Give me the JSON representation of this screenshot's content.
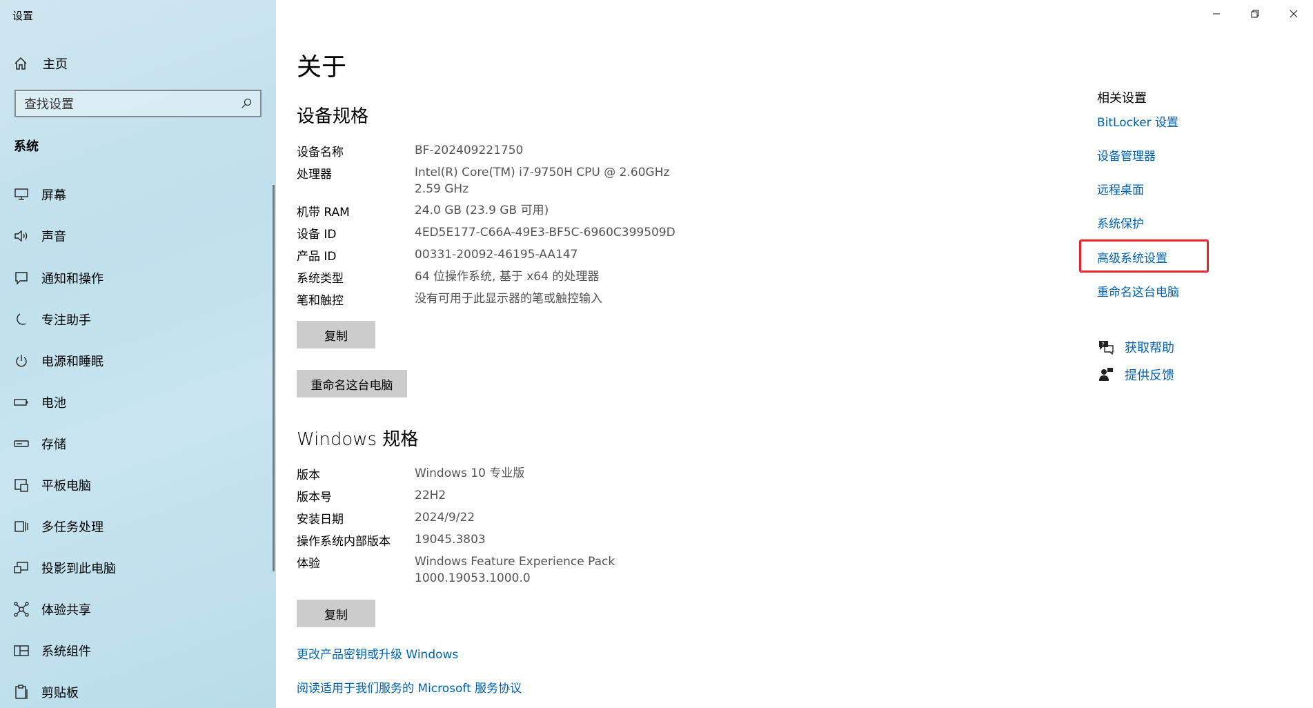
{
  "window": {
    "title": "设置"
  },
  "sidebar": {
    "home_label": "主页",
    "search_placeholder": "查找设置",
    "section": "系统",
    "items": [
      {
        "icon": "monitor-icon",
        "label": "屏幕"
      },
      {
        "icon": "speaker-icon",
        "label": "声音"
      },
      {
        "icon": "notification-icon",
        "label": "通知和操作"
      },
      {
        "icon": "moon-icon",
        "label": "专注助手"
      },
      {
        "icon": "power-icon",
        "label": "电源和睡眠"
      },
      {
        "icon": "battery-icon",
        "label": "电池"
      },
      {
        "icon": "storage-icon",
        "label": "存储"
      },
      {
        "icon": "tablet-icon",
        "label": "平板电脑"
      },
      {
        "icon": "multitask-icon",
        "label": "多任务处理"
      },
      {
        "icon": "project-icon",
        "label": "投影到此电脑"
      },
      {
        "icon": "share-icon",
        "label": "体验共享"
      },
      {
        "icon": "components-icon",
        "label": "系统组件"
      },
      {
        "icon": "clipboard-icon",
        "label": "剪贴板"
      }
    ]
  },
  "main": {
    "title": "关于",
    "device": {
      "heading": "设备规格",
      "rows": [
        {
          "k": "设备名称",
          "v": "BF-202409221750"
        },
        {
          "k": "处理器",
          "v": "Intel(R) Core(TM) i7-9750H CPU @ 2.60GHz   2.59 GHz"
        },
        {
          "k": "机带 RAM",
          "v": "24.0 GB (23.9 GB 可用)"
        },
        {
          "k": "设备 ID",
          "v": "4ED5E177-C66A-49E3-BF5C-6960C399509D"
        },
        {
          "k": "产品 ID",
          "v": "00331-20092-46195-AA147"
        },
        {
          "k": "系统类型",
          "v": "64 位操作系统, 基于 x64 的处理器"
        },
        {
          "k": "笔和触控",
          "v": "没有可用于此显示器的笔或触控输入"
        }
      ],
      "copy_label": "复制",
      "rename_label": "重命名这台电脑"
    },
    "windows": {
      "heading": "Windows 规格",
      "rows": [
        {
          "k": "版本",
          "v": "Windows 10 专业版"
        },
        {
          "k": "版本号",
          "v": "22H2"
        },
        {
          "k": "安装日期",
          "v": "2024/9/22"
        },
        {
          "k": "操作系统内部版本",
          "v": "19045.3803"
        },
        {
          "k": "体验",
          "v": "Windows Feature Experience Pack 1000.19053.1000.0"
        }
      ],
      "copy_label": "复制"
    },
    "links": {
      "change_key": "更改产品密钥或升级 Windows",
      "agreement": "阅读适用于我们服务的 Microsoft 服务协议"
    }
  },
  "related": {
    "title": "相关设置",
    "links": [
      "BitLocker 设置",
      "设备管理器",
      "远程桌面",
      "系统保护",
      "高级系统设置",
      "重命名这台电脑"
    ],
    "help": "获取帮助",
    "feedback": "提供反馈"
  },
  "colors": {
    "link": "#0063b1",
    "highlight": "#e8232d",
    "button": "#cccccc"
  }
}
